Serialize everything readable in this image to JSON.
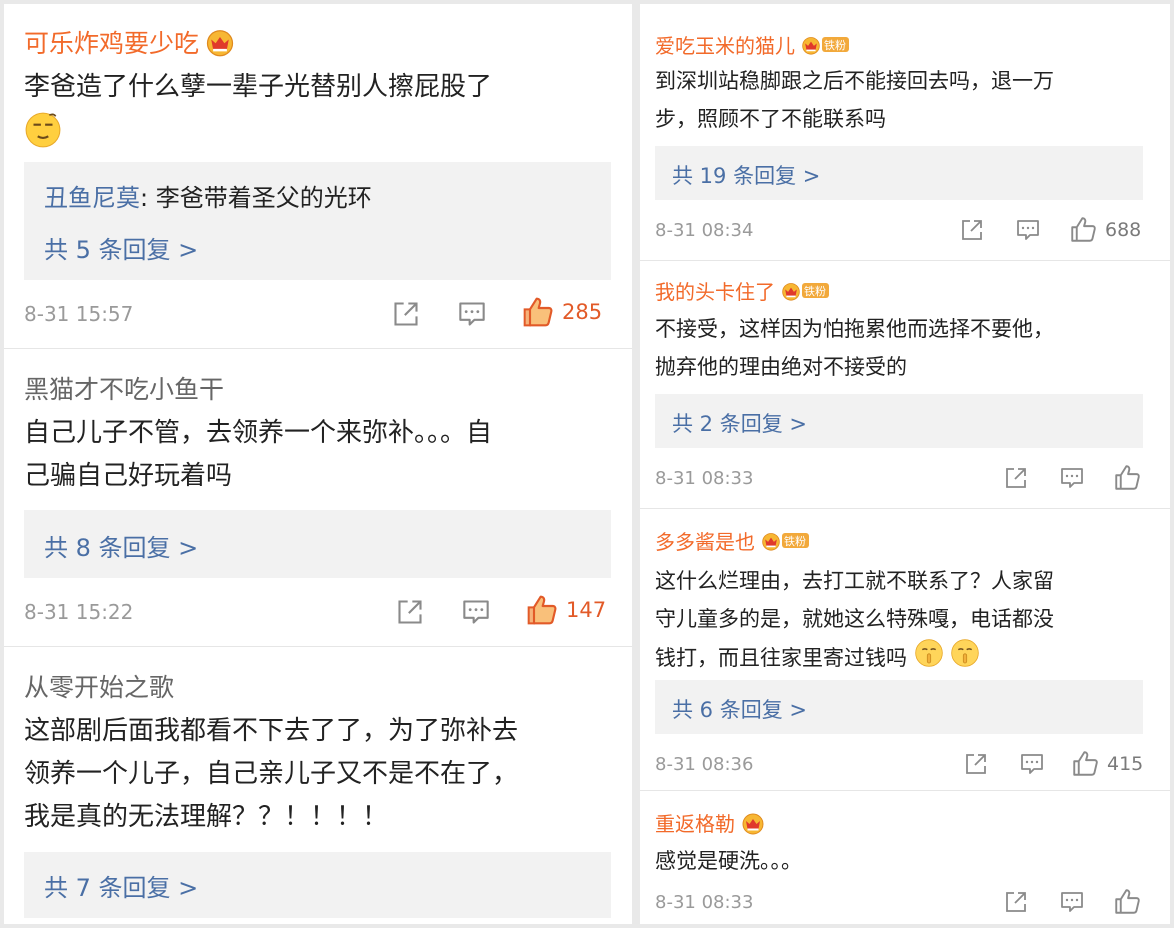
{
  "left_comments": [
    {
      "username": "可乐炸鸡要少吃",
      "body": "李爸造了什么孽一辈子光替别人擦屁股了",
      "reply_preview_name": "丑鱼尼莫",
      "reply_preview_text": ": 李爸带着圣父的光环",
      "reply_more": "共 5 条回复 >",
      "time": "8-31 15:57",
      "likes": "285"
    },
    {
      "username": "黑猫才不吃小鱼干",
      "body_line1": "自己儿子不管，去领养一个来弥补。。。自",
      "body_line2": "己骗自己好玩着吗",
      "reply_more": "共 8 条回复 >",
      "time": "8-31 15:22",
      "likes": "147"
    },
    {
      "username": "从零开始之歌",
      "body_line1": "这部剧后面我都看不下去了了，为了弥补去",
      "body_line2": "领养一个儿子，自己亲儿子又不是不在了，",
      "body_line3": "我是真的无法理解？？！！！！",
      "reply_more": "共 7 条回复 >"
    }
  ],
  "right_comments": [
    {
      "username": "爱吃玉米的猫儿",
      "badge": "铁粉",
      "body_line1": "到深圳站稳脚跟之后不能接回去吗，退一万",
      "body_line2": "步，照顾不了不能联系吗",
      "reply_more": "共 19 条回复 >",
      "time": "8-31 08:34",
      "likes": "688"
    },
    {
      "username": "我的头卡住了",
      "badge": "铁粉",
      "body_line1": "不接受，这样因为怕拖累他而选择不要他，",
      "body_line2": "抛弃他的理由绝对不接受的",
      "reply_more": "共 2 条回复 >",
      "time": "8-31 08:33"
    },
    {
      "username": "多多酱是也",
      "badge": "铁粉",
      "body_line1": "这什么烂理由，去打工就不联系了？人家留",
      "body_line2": "守儿童多的是，就她这么特殊嘎，电话都没",
      "body_line3": "钱打，而且往家里寄过钱吗",
      "reply_more": "共 6 条回复 >",
      "time": "8-31 08:36",
      "likes": "415"
    },
    {
      "username": "重返格勒",
      "body": "感觉是硬洗。。。",
      "time": "8-31 08:33"
    }
  ],
  "colors": {
    "username": "#f26a2a",
    "link": "#4a6fa5",
    "hot_like": "#e25a28"
  },
  "icons": [
    "vip-crown-icon",
    "fan-badge-icon",
    "share-icon",
    "comment-icon",
    "thumbs-up-icon",
    "thinking-emoji",
    "shush-emoji"
  ]
}
